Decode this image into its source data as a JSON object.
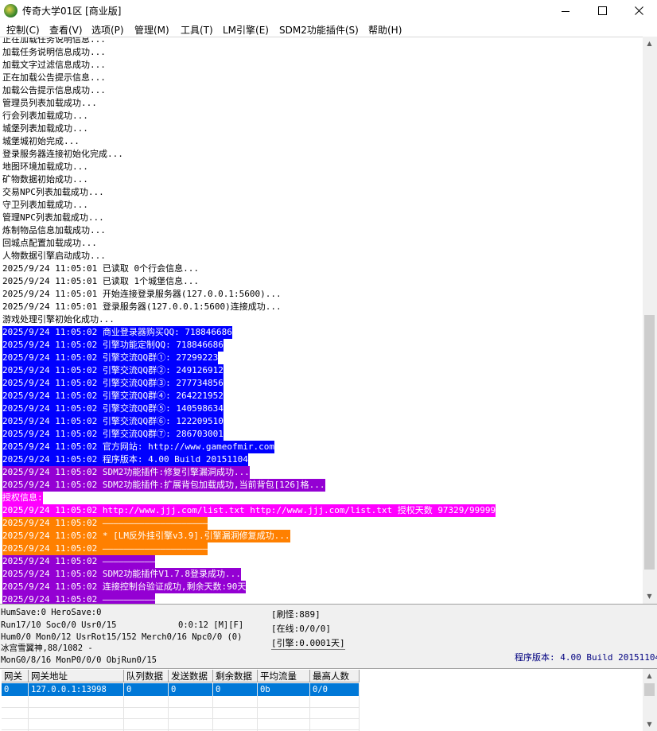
{
  "window": {
    "title": "传奇大学01区 [商业版]",
    "icon": "dragon-app-icon",
    "buttons": [
      "minimize-icon",
      "maximize-icon",
      "close-icon"
    ]
  },
  "menu": [
    {
      "label": "控制(C)"
    },
    {
      "label": "查看(V)"
    },
    {
      "label": "选项(P)"
    },
    {
      "label": "管理(M)"
    },
    {
      "label": "工具(T)"
    },
    {
      "label": "LM引擎(E)"
    },
    {
      "label": "SDM2功能插件(S)"
    },
    {
      "label": "帮助(H)"
    }
  ],
  "log": {
    "colors": {
      "blue": "#0000ff",
      "purple": "#9400d3",
      "magenta": "#ff00ff",
      "orange": "#ff8000",
      "text_on_color": "#ffffff"
    },
    "lines": [
      {
        "text": "正在加载任务说明信息...",
        "bg": ""
      },
      {
        "text": "加载任务说明信息成功...",
        "bg": ""
      },
      {
        "text": "加载文字过滤信息成功...",
        "bg": ""
      },
      {
        "text": "正在加载公告提示信息...",
        "bg": ""
      },
      {
        "text": "加载公告提示信息成功...",
        "bg": ""
      },
      {
        "text": "管理员列表加载成功...",
        "bg": ""
      },
      {
        "text": "行会列表加载成功...",
        "bg": ""
      },
      {
        "text": "城堡列表加载成功...",
        "bg": ""
      },
      {
        "text": "城堡城初始完成...",
        "bg": ""
      },
      {
        "text": "登录服务器连接初始化完成...",
        "bg": ""
      },
      {
        "text": "地图环境加载成功...",
        "bg": ""
      },
      {
        "text": "矿物数据初始成功...",
        "bg": ""
      },
      {
        "text": "交易NPC列表加载成功...",
        "bg": ""
      },
      {
        "text": "守卫列表加载成功...",
        "bg": ""
      },
      {
        "text": "管理NPC列表加载成功...",
        "bg": ""
      },
      {
        "text": "炼制物品信息加载成功...",
        "bg": ""
      },
      {
        "text": "回城点配置加载成功...",
        "bg": ""
      },
      {
        "text": "人物数据引擎启动成功...",
        "bg": ""
      },
      {
        "text": "2025/9/24 11:05:01 已读取 0个行会信息...",
        "bg": ""
      },
      {
        "text": "2025/9/24 11:05:01 已读取 1个城堡信息...",
        "bg": ""
      },
      {
        "text": "2025/9/24 11:05:01 开始连接登录服务器(127.0.0.1:5600)...",
        "bg": ""
      },
      {
        "text": "2025/9/24 11:05:01 登录服务器(127.0.0.1:5600)连接成功...",
        "bg": ""
      },
      {
        "text": "游戏处理引擎初始化成功...",
        "bg": ""
      },
      {
        "text": "2025/9/24 11:05:02 商业登录器购买QQ: 718846686",
        "bg": "blue"
      },
      {
        "text": "2025/9/24 11:05:02 引擎功能定制QQ: 718846686",
        "bg": "blue"
      },
      {
        "text": "2025/9/24 11:05:02 引擎交流QQ群①: 27299223",
        "bg": "blue"
      },
      {
        "text": "2025/9/24 11:05:02 引擎交流QQ群②: 249126912",
        "bg": "blue"
      },
      {
        "text": "2025/9/24 11:05:02 引擎交流QQ群③: 277734856",
        "bg": "blue"
      },
      {
        "text": "2025/9/24 11:05:02 引擎交流QQ群④: 264221952",
        "bg": "blue"
      },
      {
        "text": "2025/9/24 11:05:02 引擎交流QQ群⑤: 140598634",
        "bg": "blue"
      },
      {
        "text": "2025/9/24 11:05:02 引擎交流QQ群⑥: 122209510",
        "bg": "blue"
      },
      {
        "text": "2025/9/24 11:05:02 引擎交流QQ群⑦: 286703001",
        "bg": "blue"
      },
      {
        "text": "2025/9/24 11:05:02 官方网站: http://www.gameofmir.com",
        "bg": "blue"
      },
      {
        "text": "2025/9/24 11:05:02 程序版本: 4.00 Build 20151104",
        "bg": "blue"
      },
      {
        "text": "2025/9/24 11:05:02 SDM2功能插件:修复引擎漏洞成功...",
        "bg": "purple"
      },
      {
        "text": "2025/9/24 11:05:02 SDM2功能插件:扩展背包加载成功,当前背包[126]格...",
        "bg": "purple"
      },
      {
        "text": "授权信息:",
        "bg": "magenta"
      },
      {
        "text": "2025/9/24 11:05:02 http://www.jjj.com/list.txt http://www.jjj.com/list.txt 授权天数 97329/99999",
        "bg": "magenta"
      },
      {
        "text": "2025/9/24 11:05:02 ————————————————————",
        "bg": "orange"
      },
      {
        "text": "2025/9/24 11:05:02 * [LM反外挂引擎v3.9].引擎漏洞修复成功...",
        "bg": "orange"
      },
      {
        "text": "2025/9/24 11:05:02 ————————————————————",
        "bg": "orange"
      },
      {
        "text": "2025/9/24 11:05:02 ——————————",
        "bg": "purple"
      },
      {
        "text": "2025/9/24 11:05:02 SDM2功能插件V1.7.8登录成功...",
        "bg": "purple"
      },
      {
        "text": "2025/9/24 11:05:02 连接控制台验证成功,剩余天数:90天",
        "bg": "purple"
      },
      {
        "text": "2025/9/24 11:05:02 ——————————",
        "bg": "purple"
      }
    ]
  },
  "status": {
    "line1": "HumSave:0 HeroSave:0",
    "line2": "Run17/10 Soc0/0 Usr0/15",
    "timer": "0:0:12 [M][F]",
    "line3": "Hum0/0 Mon0/12 UsrRot15/152 Merch0/16 Npc0/0 (0)",
    "line4": "冰宫雪翼神,88/1082 -",
    "line5": "MonG0/8/16 MonP0/0/0 ObjRun0/15",
    "box1": "[刷怪:889]",
    "box2": "[在线:0/0/0]",
    "box3": "[引擎:0.0001天]",
    "version": "程序版本: 4.00 Build 20151104",
    "version_color": "#000080"
  },
  "gateway": {
    "columns": [
      "网关",
      "网关地址",
      "队列数据",
      "发送数据",
      "剩余数据",
      "平均流量",
      "最高人数"
    ],
    "rows": [
      [
        "0",
        "127.0.0.1:13998",
        "0",
        "0",
        "0",
        "0b",
        "0/0"
      ]
    ],
    "selected_color": "#0078d7"
  }
}
